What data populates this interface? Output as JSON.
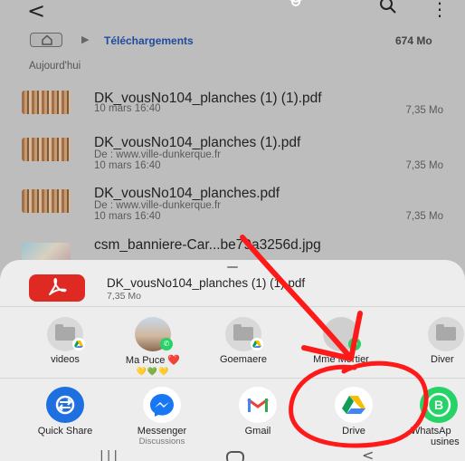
{
  "header": {
    "back_icon": "chevron-left-icon",
    "share_icon": "share-icon",
    "search_icon": "search-icon",
    "more_icon": "more-vertical-icon"
  },
  "path": {
    "folder": "Téléchargements",
    "size": "674 Mo"
  },
  "section_label": "Aujourd'hui",
  "files": [
    {
      "name": "DK_vousNo104_planches (1) (1).pdf",
      "source": "",
      "date": "10 mars 16:40",
      "size": "7,35 Mo"
    },
    {
      "name": "DK_vousNo104_planches (1).pdf",
      "source": "De : www.ville-dunkerque.fr",
      "date": "10 mars 16:40",
      "size": "7,35 Mo"
    },
    {
      "name": "DK_vousNo104_planches.pdf",
      "source": "De : www.ville-dunkerque.fr",
      "date": "10 mars 16:40",
      "size": "7,35 Mo"
    },
    {
      "name": "csm_banniere-Car...be79a3256d.jpg",
      "source": "",
      "date": "",
      "size": ""
    }
  ],
  "share_sheet": {
    "file_name": "DK_vousNo104_planches (1) (1).pdf",
    "file_size": "7,35 Mo",
    "contacts": [
      {
        "label": "videos",
        "emojis": ""
      },
      {
        "label": "Ma Puce ❤️",
        "emojis": "💛💚💛"
      },
      {
        "label": "Goemaere",
        "emojis": ""
      },
      {
        "label": "Mme Mortier",
        "emojis": ""
      },
      {
        "label": "Diver",
        "emojis": ""
      }
    ],
    "apps": [
      {
        "label": "Quick Share",
        "sub": ""
      },
      {
        "label": "Messenger",
        "sub": "Discussions"
      },
      {
        "label": "Gmail",
        "sub": ""
      },
      {
        "label": "Drive",
        "sub": ""
      },
      {
        "label": "WhatsAp",
        "sub": "usines"
      }
    ]
  },
  "colors": {
    "accent_blue": "#1f4a9e",
    "pdf_red": "#de2a23",
    "annotation_red": "#ff1a1a",
    "whatsapp_green": "#25d366"
  }
}
